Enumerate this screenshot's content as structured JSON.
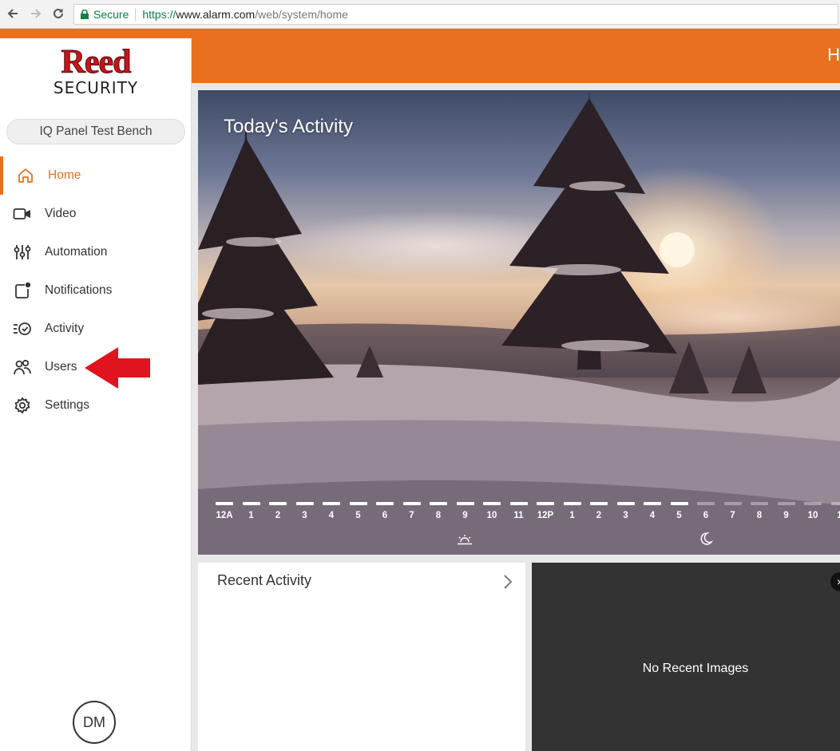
{
  "browser": {
    "back_icon": "arrow-left-icon",
    "forward_icon": "arrow-right-icon",
    "reload_icon": "reload-icon",
    "secure_label": "Secure",
    "url_scheme": "https://",
    "url_host": "www.alarm.com",
    "url_path": "/web/system/home"
  },
  "header": {
    "title": "H"
  },
  "brand": {
    "name": "Reed",
    "tagline": "SECURITY"
  },
  "system_name": "IQ Panel Test Bench",
  "sidebar": {
    "items": [
      {
        "label": "Home",
        "icon": "home-icon",
        "active": true
      },
      {
        "label": "Video",
        "icon": "video-camera-icon"
      },
      {
        "label": "Automation",
        "icon": "sliders-icon"
      },
      {
        "label": "Notifications",
        "icon": "notification-icon"
      },
      {
        "label": "Activity",
        "icon": "activity-list-icon"
      },
      {
        "label": "Users",
        "icon": "users-icon"
      },
      {
        "label": "Settings",
        "icon": "gear-icon"
      }
    ]
  },
  "user_initials": "DM",
  "hero": {
    "title": "Today's Activity",
    "hours": [
      "12A",
      "1",
      "2",
      "3",
      "4",
      "5",
      "6",
      "7",
      "8",
      "9",
      "10",
      "11",
      "12P",
      "1",
      "2",
      "3",
      "4",
      "5",
      "6",
      "7",
      "8",
      "9",
      "10",
      "1"
    ],
    "elapsed_hours": 18
  },
  "recent_activity": {
    "title": "Recent Activity"
  },
  "recent_images": {
    "empty_text": "No Recent Images",
    "close_label": "×"
  },
  "colors": {
    "accent": "#e8701e",
    "brand_red": "#c4161c",
    "annotation_arrow": "#e0141e"
  }
}
